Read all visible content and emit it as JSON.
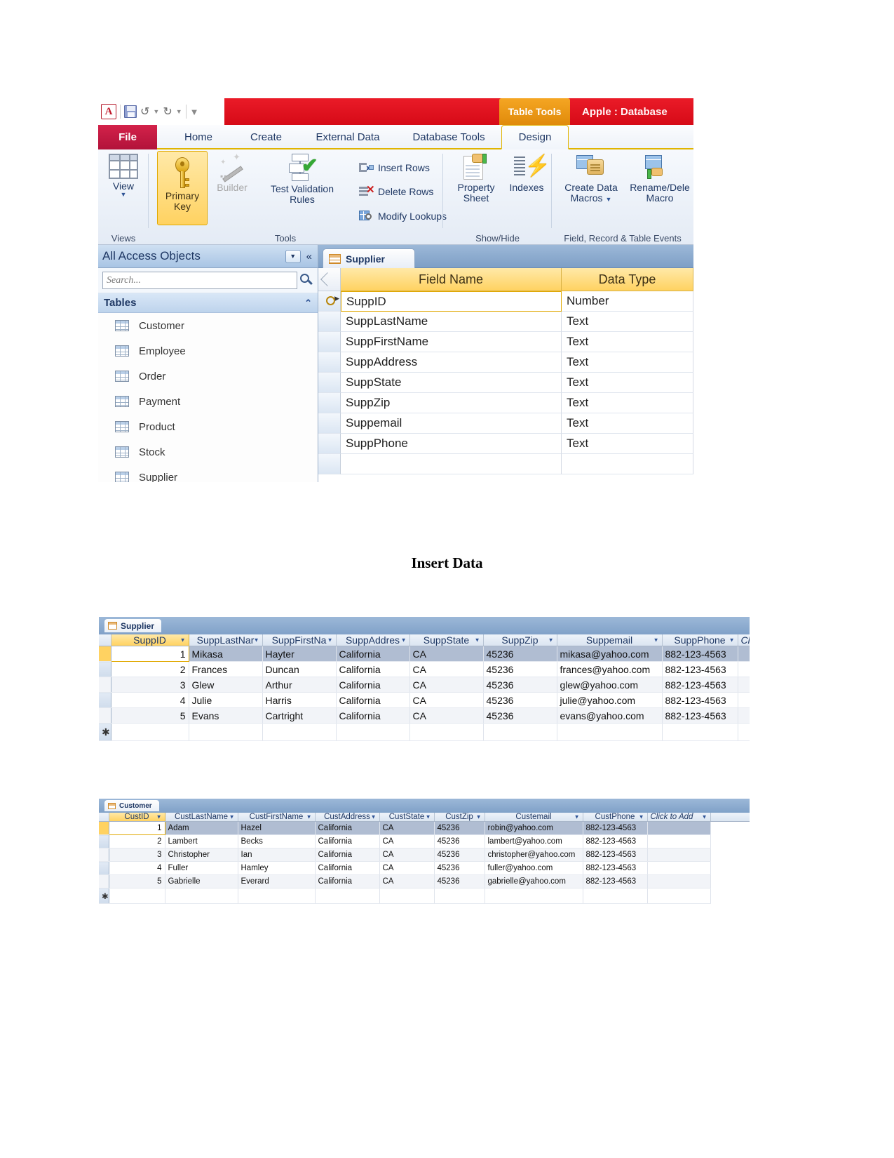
{
  "access": {
    "quick_access": {
      "app_icon": "access-logo-icon",
      "save_icon": "save-icon",
      "undo_icon": "undo-icon",
      "redo_icon": "redo-icon",
      "customize_icon": "customize-quick-access-icon"
    },
    "contextual_tab_title": "Table Tools",
    "document_title": "Apple : Database",
    "tabs": [
      {
        "label": "File",
        "active": false
      },
      {
        "label": "Home",
        "active": false
      },
      {
        "label": "Create",
        "active": false
      },
      {
        "label": "External Data",
        "active": false
      },
      {
        "label": "Database Tools",
        "active": false
      },
      {
        "label": "Design",
        "active": true
      }
    ],
    "ribbon": {
      "groups": [
        {
          "name": "Views"
        },
        {
          "name": "Tools"
        },
        {
          "name": "Show/Hide"
        },
        {
          "name": "Field, Record & Table Events"
        }
      ],
      "views": {
        "button": "View",
        "icon": "datasheet-view-icon"
      },
      "tools": {
        "primary_key": "Primary\nKey",
        "primary_key_line1": "Primary",
        "primary_key_line2": "Key",
        "builder": "Builder",
        "test_validation_line1": "Test Validation",
        "test_validation_line2": "Rules",
        "insert_rows": "Insert Rows",
        "delete_rows": "Delete Rows",
        "modify_lookups": "Modify Lookups"
      },
      "show_hide": {
        "property_sheet_line1": "Property",
        "property_sheet_line2": "Sheet",
        "indexes": "Indexes"
      },
      "events": {
        "create_data_macros_line1": "Create Data",
        "create_data_macros_line2": "Macros",
        "rename_delete_macro_line1": "Rename/Dele",
        "rename_delete_macro_line2": "Macro"
      }
    },
    "nav_pane": {
      "title": "All Access Objects",
      "search_placeholder": "Search...",
      "group_label": "Tables",
      "items": [
        {
          "label": "Customer"
        },
        {
          "label": "Employee"
        },
        {
          "label": "Order"
        },
        {
          "label": "Payment"
        },
        {
          "label": "Product"
        },
        {
          "label": "Stock"
        },
        {
          "label": "Supplier"
        }
      ]
    },
    "design_view": {
      "document_tab": "Supplier",
      "columns": [
        "Field Name",
        "Data Type"
      ],
      "rows": [
        {
          "field": "SuppID",
          "type": "Number",
          "primary_key": true
        },
        {
          "field": "SuppLastName",
          "type": "Text",
          "primary_key": false
        },
        {
          "field": "SuppFirstName",
          "type": "Text",
          "primary_key": false
        },
        {
          "field": "SuppAddress",
          "type": "Text",
          "primary_key": false
        },
        {
          "field": "SuppState",
          "type": "Text",
          "primary_key": false
        },
        {
          "field": "SuppZip",
          "type": "Text",
          "primary_key": false
        },
        {
          "field": "Suppemail",
          "type": "Text",
          "primary_key": false
        },
        {
          "field": "SuppPhone",
          "type": "Text",
          "primary_key": false
        }
      ]
    }
  },
  "section_heading": "Insert Data",
  "supplier_sheet": {
    "tab_label": "Supplier",
    "columns": [
      "SuppID",
      "SuppLastNar",
      "SuppFirstNa",
      "SuppAddres",
      "SuppState",
      "SuppZip",
      "Suppemail",
      "SuppPhone",
      "Cli"
    ],
    "new_record_marker": "✱",
    "rows": [
      {
        "id": "1",
        "last": "Mikasa",
        "first": "Hayter",
        "address": "California",
        "state": "CA",
        "zip": "45236",
        "email": "mikasa@yahoo.com",
        "phone": "882-123-4563"
      },
      {
        "id": "2",
        "last": "Frances",
        "first": "Duncan",
        "address": "California",
        "state": "CA",
        "zip": "45236",
        "email": "frances@yahoo.com",
        "phone": "882-123-4563"
      },
      {
        "id": "3",
        "last": "Glew",
        "first": "Arthur",
        "address": "California",
        "state": "CA",
        "zip": "45236",
        "email": "glew@yahoo.com",
        "phone": "882-123-4563"
      },
      {
        "id": "4",
        "last": "Julie",
        "first": "Harris",
        "address": "California",
        "state": "CA",
        "zip": "45236",
        "email": "julie@yahoo.com",
        "phone": "882-123-4563"
      },
      {
        "id": "5",
        "last": "Evans",
        "first": "Cartright",
        "address": "California",
        "state": "CA",
        "zip": "45236",
        "email": "evans@yahoo.com",
        "phone": "882-123-4563"
      }
    ]
  },
  "customer_sheet": {
    "tab_label": "Customer",
    "columns": [
      "CustID",
      "CustLastName",
      "CustFirstName",
      "CustAddress",
      "CustState",
      "CustZip",
      "Custemail",
      "CustPhone",
      "Click to Add"
    ],
    "new_record_marker": "✱",
    "rows": [
      {
        "id": "1",
        "last": "Adam",
        "first": "Hazel",
        "address": "California",
        "state": "CA",
        "zip": "45236",
        "email": "robin@yahoo.com",
        "phone": "882-123-4563"
      },
      {
        "id": "2",
        "last": "Lambert",
        "first": "Becks",
        "address": "California",
        "state": "CA",
        "zip": "45236",
        "email": "lambert@yahoo.com",
        "phone": "882-123-4563"
      },
      {
        "id": "3",
        "last": "Christopher",
        "first": "Ian",
        "address": "California",
        "state": "CA",
        "zip": "45236",
        "email": "christopher@yahoo.com",
        "phone": "882-123-4563"
      },
      {
        "id": "4",
        "last": "Fuller",
        "first": "Hamley",
        "address": "California",
        "state": "CA",
        "zip": "45236",
        "email": "fuller@yahoo.com",
        "phone": "882-123-4563"
      },
      {
        "id": "5",
        "last": "Gabrielle",
        "first": "Everard",
        "address": "California",
        "state": "CA",
        "zip": "45236",
        "email": "gabrielle@yahoo.com",
        "phone": "882-123-4563"
      }
    ]
  }
}
